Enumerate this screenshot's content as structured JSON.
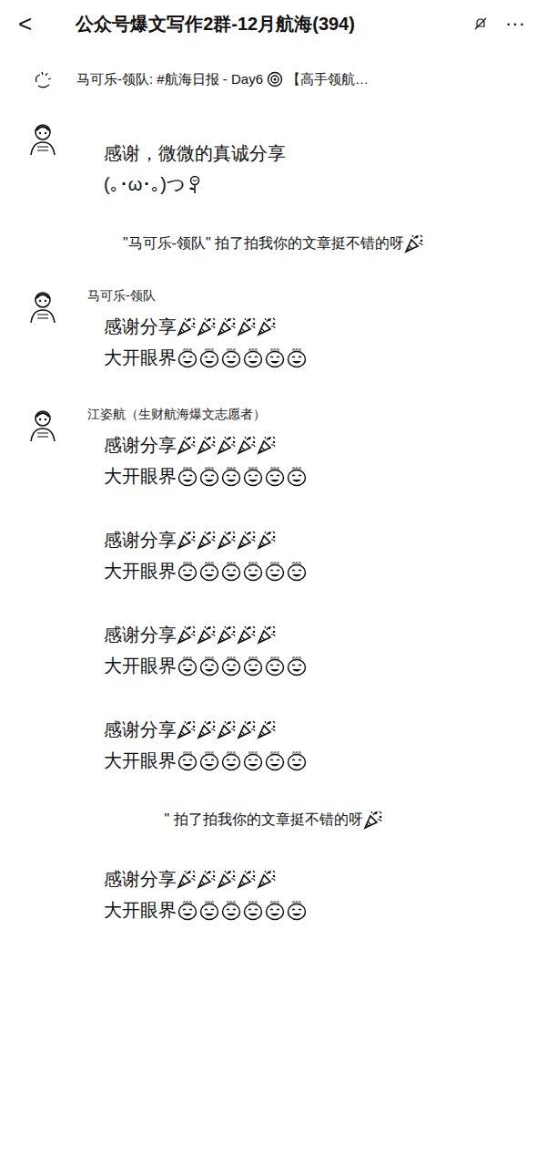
{
  "header": {
    "back": "<",
    "title": "公众号爆文写作2群-12月航海(394)",
    "more": "···"
  },
  "announcement": {
    "text": "马可乐-领队: #航海日报 - Day6",
    "emoji": "target",
    "tail": "【高手领航…"
  },
  "items": [
    {
      "kind": "message",
      "avatar": true,
      "sender": "",
      "lines": [
        {
          "text": "感谢，微微的真诚分享"
        },
        {
          "text": "(｡･ω･｡)つ",
          "emoji": {
            "kind": "flower",
            "label": "",
            "count": 1
          }
        }
      ]
    },
    {
      "kind": "system",
      "text": "\"马可乐-领队\" 拍了拍我你的文章挺不错的呀",
      "emoji": {
        "kind": "party",
        "label": "",
        "count": 1
      }
    },
    {
      "kind": "message",
      "avatar": true,
      "sender": "马可乐-领队",
      "lines": [
        {
          "text": "感谢分享",
          "emoji": {
            "kind": "party",
            "label": "",
            "count": 5
          }
        },
        {
          "text": "大开眼界",
          "emoji": {
            "kind": "face666",
            "label": "666",
            "count": 6
          }
        }
      ]
    },
    {
      "kind": "message",
      "avatar": true,
      "sender": "江姿航（生财航海爆文志愿者）",
      "lines": [
        {
          "text": "感谢分享",
          "emoji": {
            "kind": "party",
            "label": "",
            "count": 5
          }
        },
        {
          "text": "大开眼界",
          "emoji": {
            "kind": "face666",
            "label": "666",
            "count": 6
          }
        }
      ]
    },
    {
      "kind": "message",
      "avatar": false,
      "sender": "",
      "lines": [
        {
          "text": "感谢分享",
          "emoji": {
            "kind": "party",
            "label": "",
            "count": 5
          }
        },
        {
          "text": "大开眼界",
          "emoji": {
            "kind": "face666",
            "label": "666",
            "count": 6
          }
        }
      ]
    },
    {
      "kind": "message",
      "avatar": false,
      "sender": "",
      "lines": [
        {
          "text": "感谢分享",
          "emoji": {
            "kind": "party",
            "label": "",
            "count": 5
          }
        },
        {
          "text": "大开眼界",
          "emoji": {
            "kind": "face666",
            "label": "666",
            "count": 6
          }
        }
      ]
    },
    {
      "kind": "message",
      "avatar": false,
      "sender": "",
      "lines": [
        {
          "text": "感谢分享",
          "emoji": {
            "kind": "party",
            "label": "",
            "count": 5
          }
        },
        {
          "text": "大开眼界",
          "emoji": {
            "kind": "face666",
            "label": "666",
            "count": 6
          }
        }
      ]
    },
    {
      "kind": "system",
      "text": "\" 拍了拍我你的文章挺不错的呀",
      "emoji": {
        "kind": "party",
        "label": "",
        "count": 1
      }
    },
    {
      "kind": "message",
      "avatar": false,
      "sender": "",
      "lines": [
        {
          "text": "感谢分享",
          "emoji": {
            "kind": "party",
            "label": "",
            "count": 5
          }
        },
        {
          "text": "大开眼界",
          "emoji": {
            "kind": "face666",
            "label": "666",
            "count": 6
          }
        }
      ]
    }
  ]
}
